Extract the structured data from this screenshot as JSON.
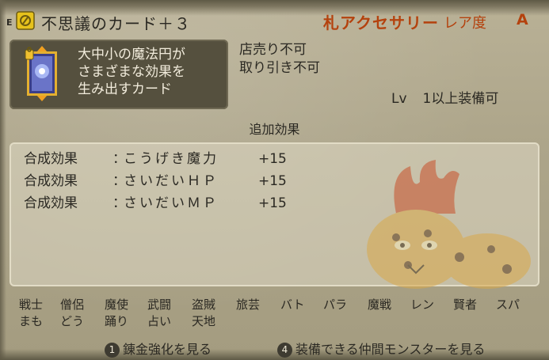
{
  "header": {
    "equip_marker": "E",
    "icon": "accessory-ring-icon",
    "item_name": "不思議のカード＋３",
    "category": "札アクセサリー",
    "rarity_label": "レア度",
    "rarity_grade": "A"
  },
  "card": {
    "icon": "card-icon",
    "description_lines": [
      "大中小の魔法円が",
      "さまざまな効果を",
      "生み出すカード"
    ]
  },
  "trade": {
    "shop_sell": "店売り不可",
    "trade": "取り引き不可"
  },
  "equip": {
    "lv_label": "Lv",
    "level_req": "1以上装備可"
  },
  "extra_effects": {
    "title": "追加効果",
    "rows": [
      {
        "label": "合成効果",
        "colon": "：",
        "name": "こうげき魔力",
        "value": "+15"
      },
      {
        "label": "合成効果",
        "colon": "：",
        "name": "さいだいＨＰ",
        "value": "+15"
      },
      {
        "label": "合成効果",
        "colon": "：",
        "name": "さいだいＭＰ",
        "value": "+15"
      }
    ]
  },
  "jobs": {
    "row1": [
      "戦士",
      "僧侶",
      "魔使",
      "武闘",
      "盗賊",
      "旅芸",
      "バト",
      "パラ",
      "魔戦",
      "レン",
      "賢者",
      "スパ"
    ],
    "row2": [
      "まも",
      "どう",
      "踊り",
      "占い",
      "天地"
    ]
  },
  "footer": {
    "button1_num": "1",
    "button1_label": "錬金強化を見る",
    "button2_num": "4",
    "button2_label": "装備できる仲間モンスターを見る"
  },
  "colors": {
    "accent": "#b4420e",
    "panel_dark": "#55503e",
    "text_light": "#f2ecdc"
  }
}
